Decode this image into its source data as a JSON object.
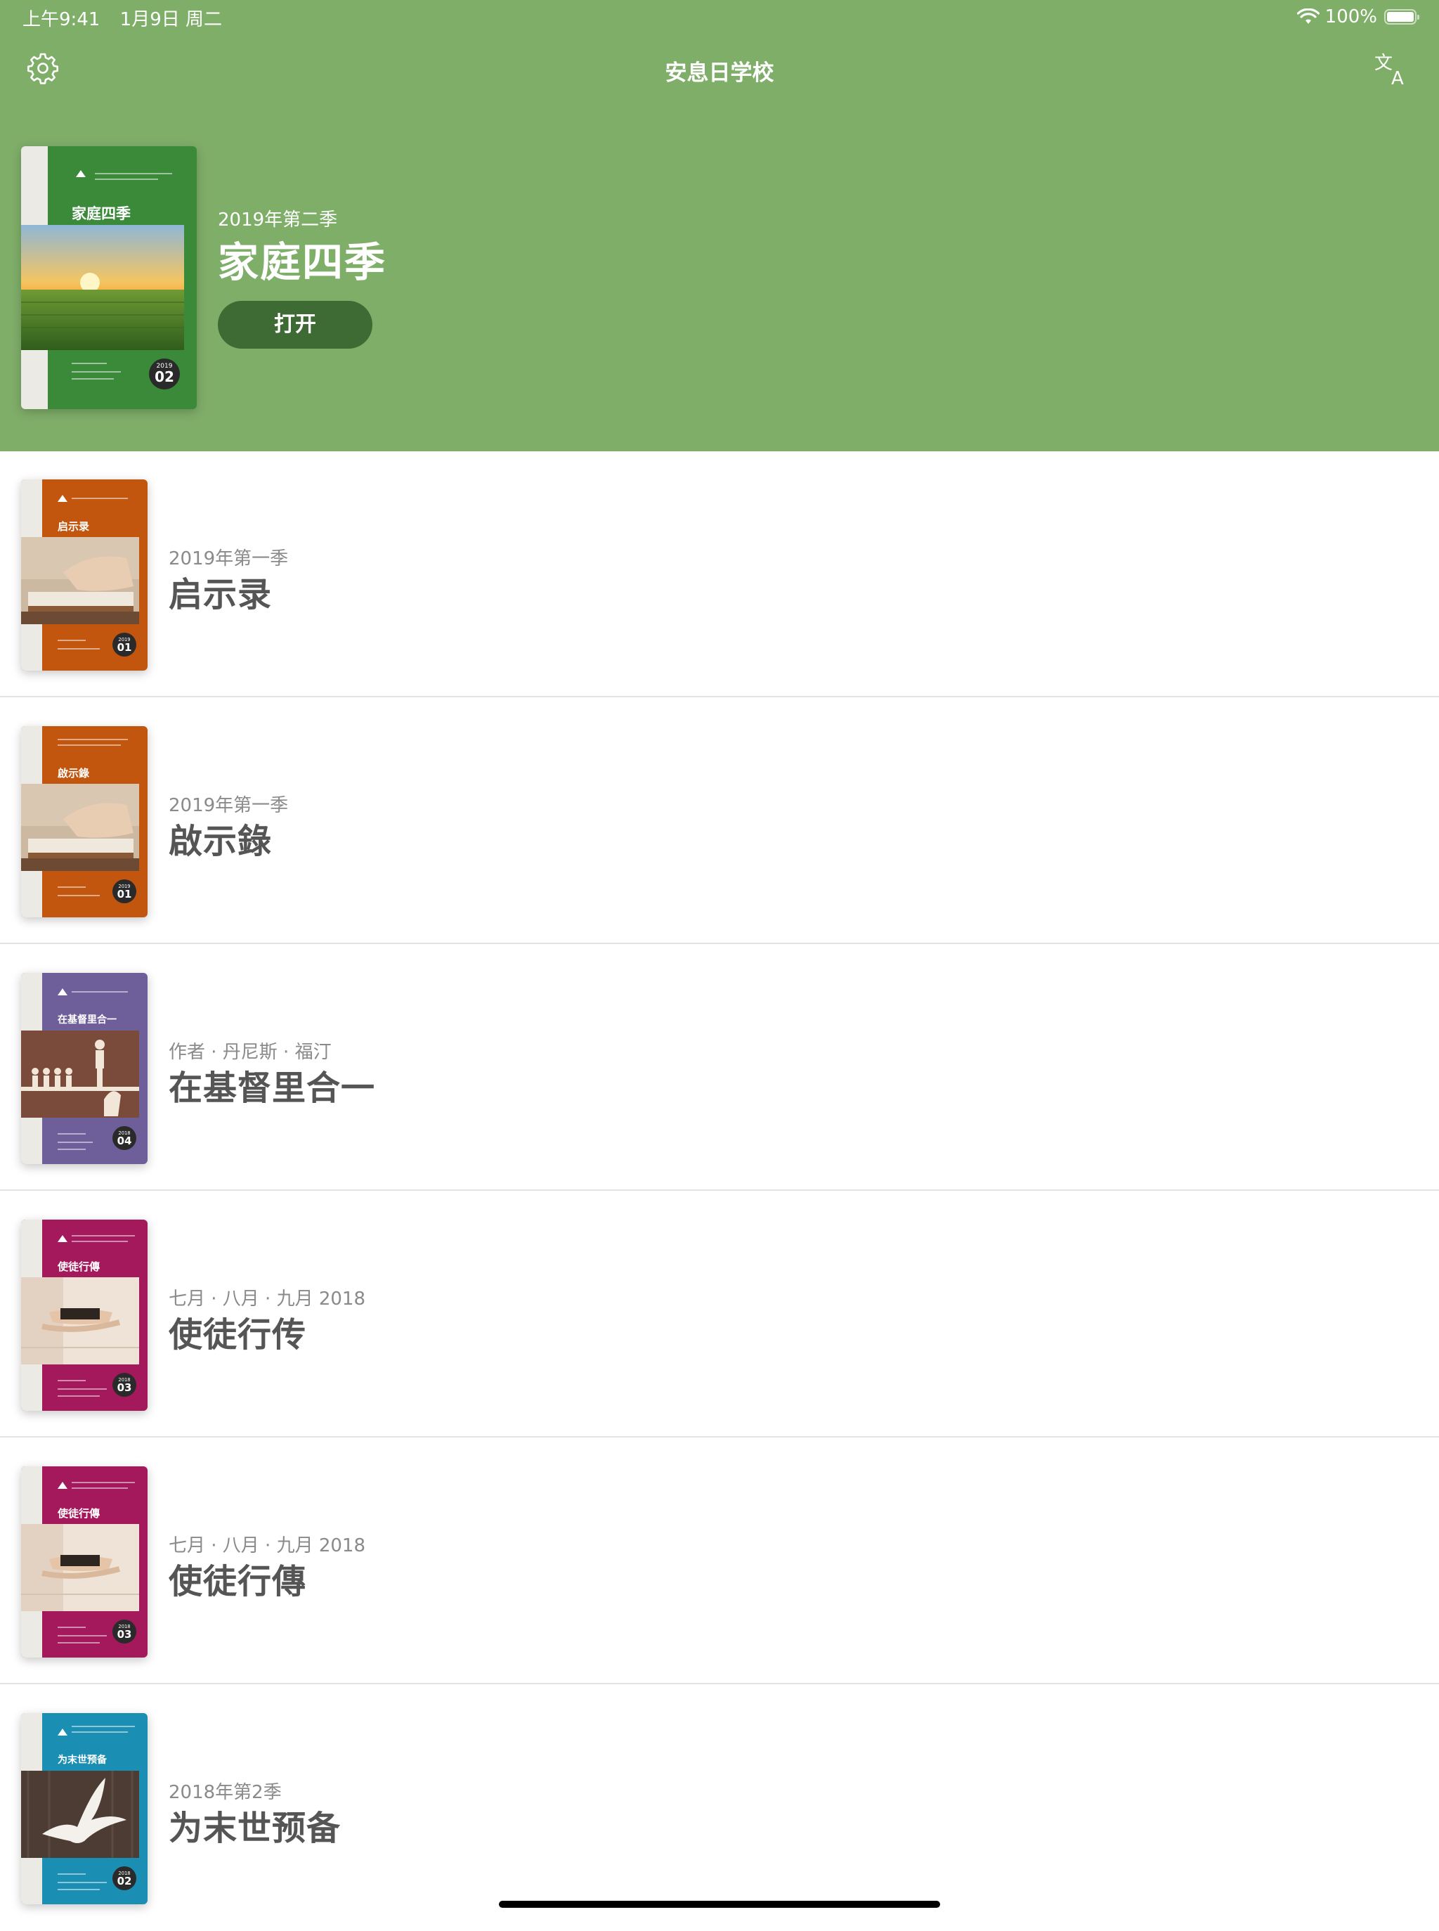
{
  "status_bar": {
    "time": "上午9:41",
    "date": "1月9日 周二",
    "battery": "100%"
  },
  "nav": {
    "title": "安息日学校",
    "settings_icon": "gear-icon",
    "language_icon": "translate-icon"
  },
  "featured": {
    "subtitle": "2019年第二季",
    "title": "家庭四季",
    "open_label": "打开",
    "cover": {
      "title": "家庭四季",
      "color": "#3a8a3a",
      "badge_year": "2019",
      "badge_num": "02"
    }
  },
  "colors": {
    "header_bg": "#7fae69",
    "button_bg": "#3e6b33",
    "separator": "#e3e3e3"
  },
  "items": [
    {
      "subtitle": "2019年第一季",
      "title": "启示录",
      "cover": {
        "title": "启示录",
        "color": "#c2560f",
        "badge_year": "2019",
        "badge_num": "01"
      }
    },
    {
      "subtitle": "2019年第一季",
      "title": "啟示錄",
      "cover": {
        "title": "啟示錄",
        "color": "#c2560f",
        "badge_year": "2019",
        "badge_num": "01"
      }
    },
    {
      "subtitle": "作者 · 丹尼斯 · 福汀",
      "title": "在基督里合一",
      "cover": {
        "title": "在基督里合一",
        "color": "#6e5e9a",
        "badge_year": "2018",
        "badge_num": "04"
      }
    },
    {
      "subtitle": "七月 · 八月 · 九月 2018",
      "title": "使徒行传",
      "cover": {
        "title": "使徒行傳",
        "color": "#a3195b",
        "badge_year": "2018",
        "badge_num": "03"
      }
    },
    {
      "subtitle": "七月 · 八月 · 九月 2018",
      "title": "使徒行傳",
      "cover": {
        "title": "使徒行傳",
        "color": "#a3195b",
        "badge_year": "2018",
        "badge_num": "03"
      }
    },
    {
      "subtitle": "2018年第2季",
      "title": "为末世预备",
      "cover": {
        "title": "为末世预备",
        "color": "#1b8fb3",
        "badge_year": "2018",
        "badge_num": "02"
      }
    }
  ]
}
